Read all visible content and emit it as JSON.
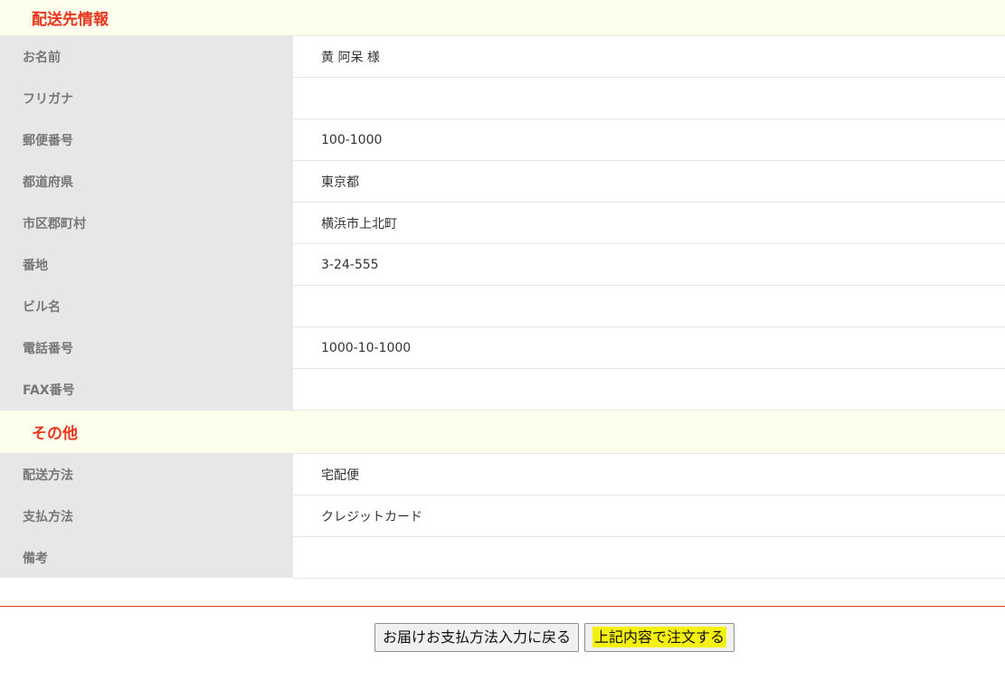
{
  "sections": {
    "shipping": {
      "title": "配送先情報",
      "rows": [
        {
          "label": "お名前",
          "value": "黄 阿呆 様"
        },
        {
          "label": "フリガナ",
          "value": ""
        },
        {
          "label": "郵便番号",
          "value": "100-1000"
        },
        {
          "label": "都道府県",
          "value": "東京都"
        },
        {
          "label": "市区郡町村",
          "value": "横浜市上北町"
        },
        {
          "label": "番地",
          "value": "3-24-555"
        },
        {
          "label": "ビル名",
          "value": ""
        },
        {
          "label": "電話番号",
          "value": "1000-10-1000"
        },
        {
          "label": "FAX番号",
          "value": ""
        }
      ]
    },
    "other": {
      "title": "その他",
      "rows": [
        {
          "label": "配送方法",
          "value": "宅配便"
        },
        {
          "label": "支払方法",
          "value": "クレジットカード"
        },
        {
          "label": "備考",
          "value": ""
        }
      ]
    }
  },
  "buttons": {
    "back_label": "お届けお支払方法入力に戻る",
    "order_label": "上記内容で注文する"
  },
  "colors": {
    "section_title": "#e8341c",
    "section_bg": "#fefeed",
    "label_bg": "#e7e7e7",
    "highlight": "#f4f00f",
    "footer_rule": "#e0411f"
  }
}
